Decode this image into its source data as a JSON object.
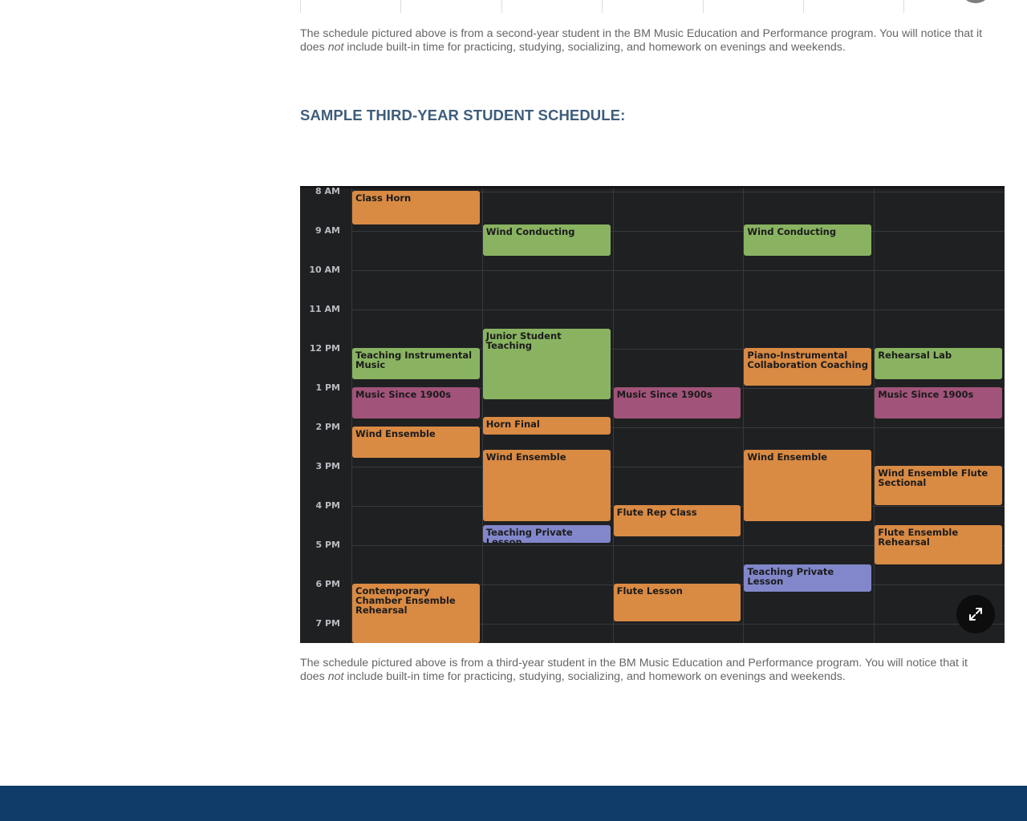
{
  "captions": {
    "second_year": {
      "before": "The schedule pictured above is from a second-year student in the BM Music Education and Performance program.  You will notice that it does ",
      "emphasis": "not",
      "after": " include built-in time for practicing, studying, socializing, and homework on evenings and weekends."
    },
    "third_year": {
      "before": "The schedule pictured above is from a third-year student in the BM Music Education and Performance program.  You will notice that it does ",
      "emphasis": "not",
      "after": " include built-in time for practicing, studying, socializing, and homework on evenings and weekends."
    }
  },
  "section_heading": "SAMPLE THIRD-YEAR STUDENT SCHEDULE:",
  "schedule": {
    "hour_labels": [
      "8 AM",
      "9 AM",
      "10 AM",
      "11 AM",
      "12 PM",
      "1 PM",
      "2 PM",
      "3 PM",
      "4 PM",
      "5 PM",
      "6 PM",
      "7 PM"
    ],
    "events": [
      {
        "day": 0,
        "start": 8.0,
        "end": 8.85,
        "title": "Class Horn",
        "color": "orange"
      },
      {
        "day": 1,
        "start": 8.85,
        "end": 9.65,
        "title": "Wind Conducting",
        "color": "green"
      },
      {
        "day": 3,
        "start": 8.85,
        "end": 9.65,
        "title": "Wind Conducting",
        "color": "green"
      },
      {
        "day": 1,
        "start": 11.5,
        "end": 13.3,
        "title": "Junior Student Teaching",
        "color": "green"
      },
      {
        "day": 0,
        "start": 12.0,
        "end": 12.8,
        "title": "Teaching Instrumental Music",
        "color": "green"
      },
      {
        "day": 3,
        "start": 12.0,
        "end": 12.95,
        "title": "Piano-Instrumental Collaboration Coaching",
        "color": "orange"
      },
      {
        "day": 4,
        "start": 12.0,
        "end": 12.8,
        "title": "Rehearsal Lab",
        "color": "green"
      },
      {
        "day": 0,
        "start": 13.0,
        "end": 13.8,
        "title": "Music Since 1900s",
        "color": "magenta"
      },
      {
        "day": 2,
        "start": 13.0,
        "end": 13.8,
        "title": "Music Since 1900s",
        "color": "magenta"
      },
      {
        "day": 4,
        "start": 13.0,
        "end": 13.8,
        "title": "Music Since 1900s",
        "color": "magenta"
      },
      {
        "day": 1,
        "start": 13.75,
        "end": 14.2,
        "title": "Horn Final",
        "color": "orange"
      },
      {
        "day": 0,
        "start": 14.0,
        "end": 14.8,
        "title": "Wind Ensemble",
        "color": "orange"
      },
      {
        "day": 1,
        "start": 14.6,
        "end": 16.4,
        "title": "Wind Ensemble",
        "color": "orange"
      },
      {
        "day": 3,
        "start": 14.6,
        "end": 16.4,
        "title": "Wind Ensemble",
        "color": "orange"
      },
      {
        "day": 4,
        "start": 15.0,
        "end": 16.0,
        "title": "Wind Ensemble Flute Sectional",
        "color": "orange"
      },
      {
        "day": 2,
        "start": 16.0,
        "end": 16.8,
        "title": "Flute Rep Class",
        "color": "orange"
      },
      {
        "day": 1,
        "start": 16.5,
        "end": 16.95,
        "title": "Teaching Private Lesson",
        "color": "purple"
      },
      {
        "day": 4,
        "start": 16.5,
        "end": 17.5,
        "title": "Flute Ensemble Rehearsal",
        "color": "orange"
      },
      {
        "day": 3,
        "start": 17.5,
        "end": 18.2,
        "title": "Teaching Private Lesson",
        "color": "purple"
      },
      {
        "day": 0,
        "start": 18.0,
        "end": 19.5,
        "title": "Contemporary Chamber Ensemble Rehearsal",
        "color": "orange"
      },
      {
        "day": 2,
        "start": 18.0,
        "end": 18.95,
        "title": "Flute Lesson",
        "color": "orange"
      }
    ]
  },
  "colors": {
    "orange": "#d98a43",
    "green": "#89b361",
    "magenta": "#a2537a",
    "purple": "#8287cb",
    "heading": "#3e5d7b",
    "footer": "#0e3b68",
    "calendar_bg": "#1f2022"
  },
  "icons": {
    "expand": "expand-arrows-icon"
  }
}
